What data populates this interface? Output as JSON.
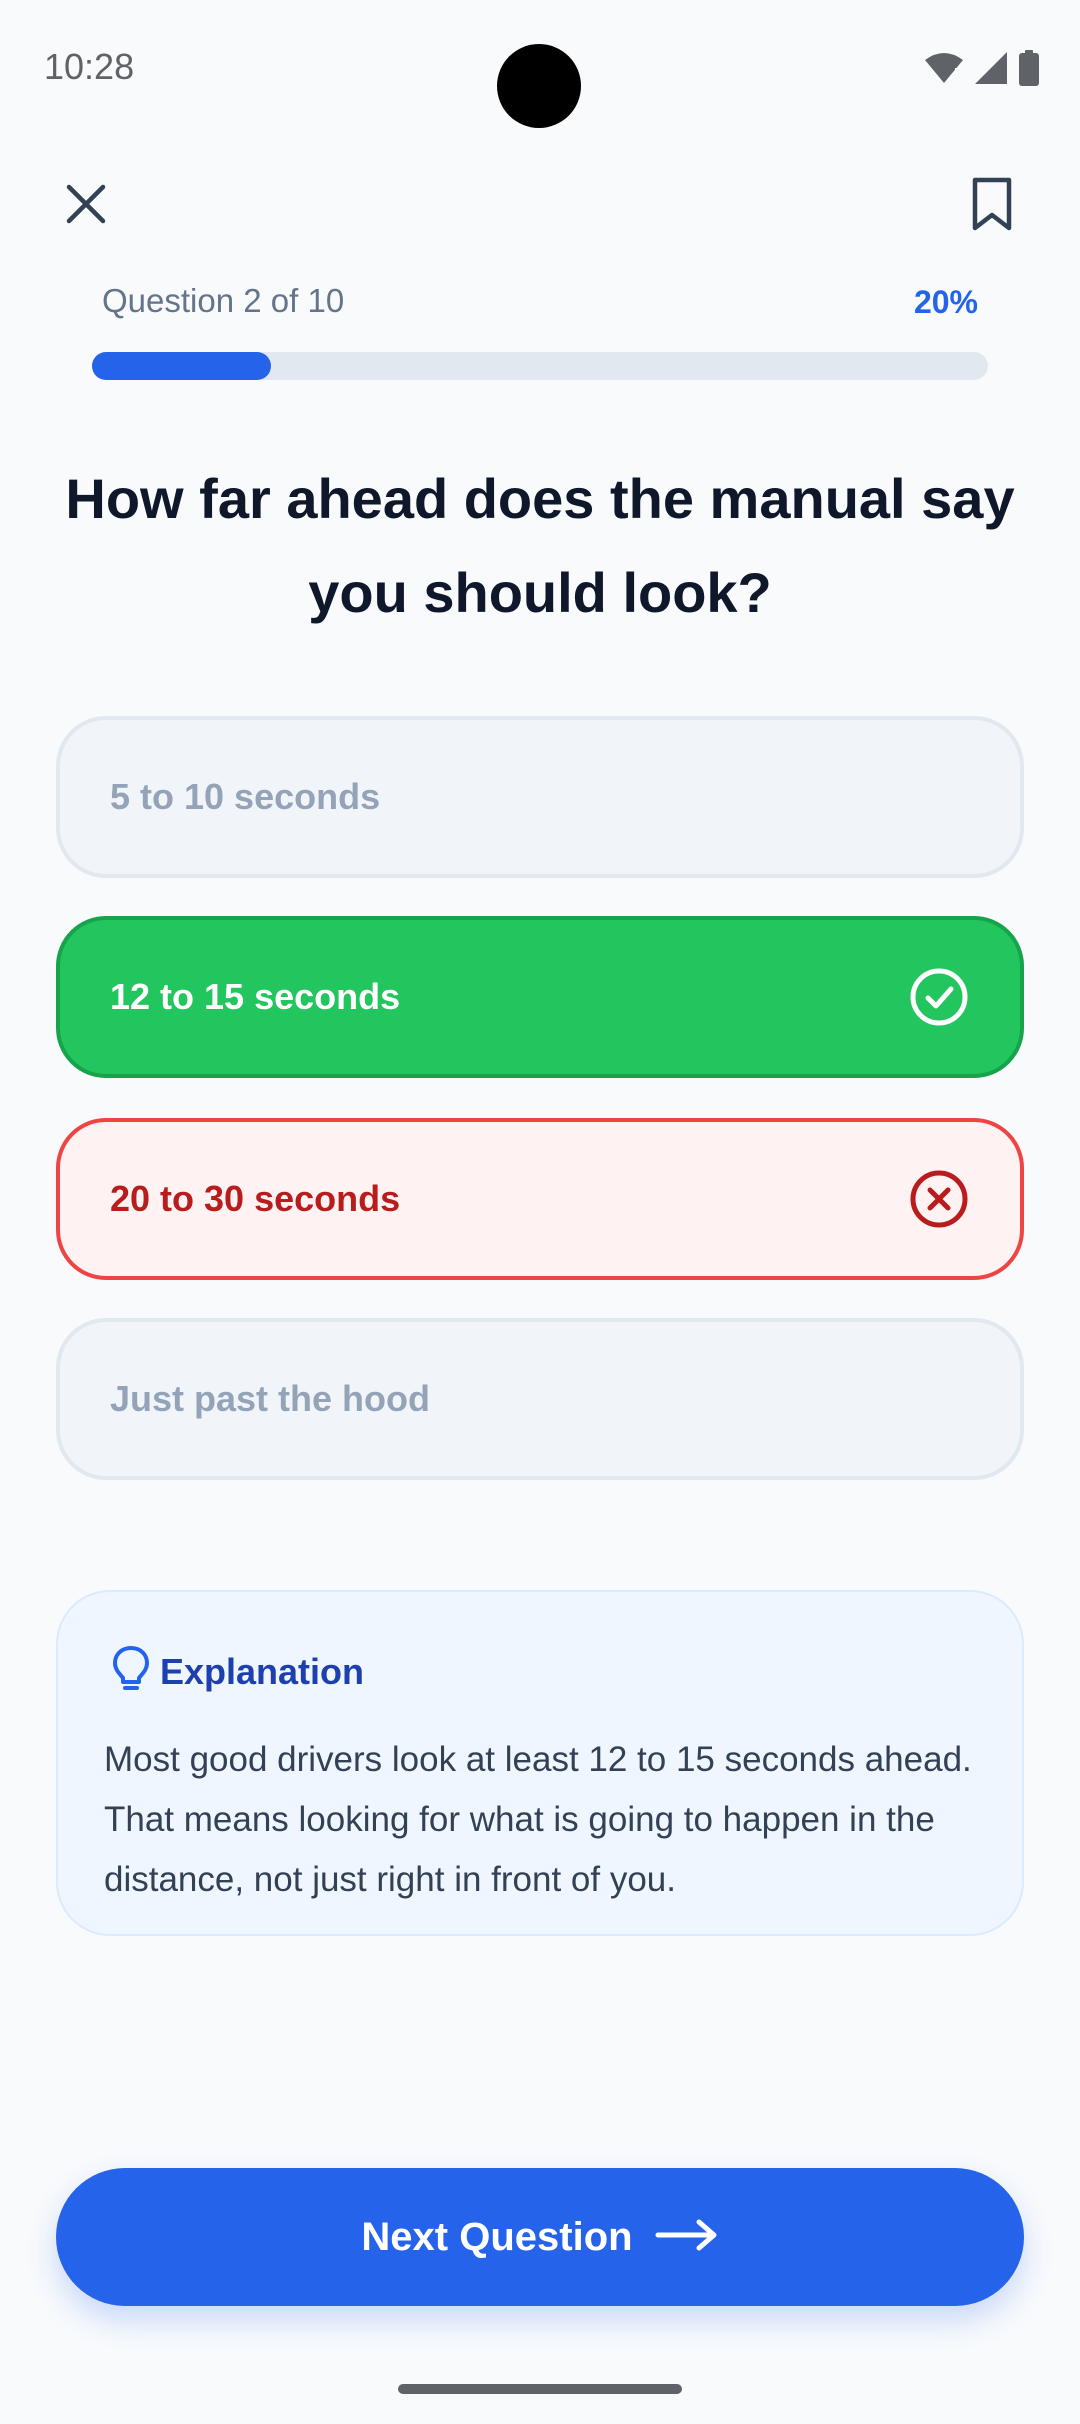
{
  "status_bar": {
    "time": "10:28",
    "icons": [
      "wifi-icon",
      "signal-icon",
      "battery-icon"
    ]
  },
  "top_bar": {
    "close_icon": "close-icon",
    "bookmark_icon": "bookmark-icon"
  },
  "progress": {
    "label": "Question 2 of 10",
    "percent_label": "20%",
    "fraction": 0.2
  },
  "question": {
    "text": "How far ahead does the manual say you should look?"
  },
  "options": [
    {
      "label": "5 to 10 seconds",
      "state": "neutral"
    },
    {
      "label": "12 to 15 seconds",
      "state": "correct"
    },
    {
      "label": "20 to 30 seconds",
      "state": "wrong"
    },
    {
      "label": "Just past the hood",
      "state": "neutral"
    }
  ],
  "explanation": {
    "title": "Explanation",
    "body": "Most good drivers look at least 12 to 15 seconds ahead. That means looking for what is going to happen in the distance, not just right in front of you.",
    "icon": "lightbulb-icon"
  },
  "next_button": {
    "label": "Next Question",
    "icon": "arrow-right-icon"
  },
  "colors": {
    "accent": "#2563eb",
    "correct": "#22c55e",
    "wrong": "#ef4444",
    "background": "#f8fafc"
  }
}
